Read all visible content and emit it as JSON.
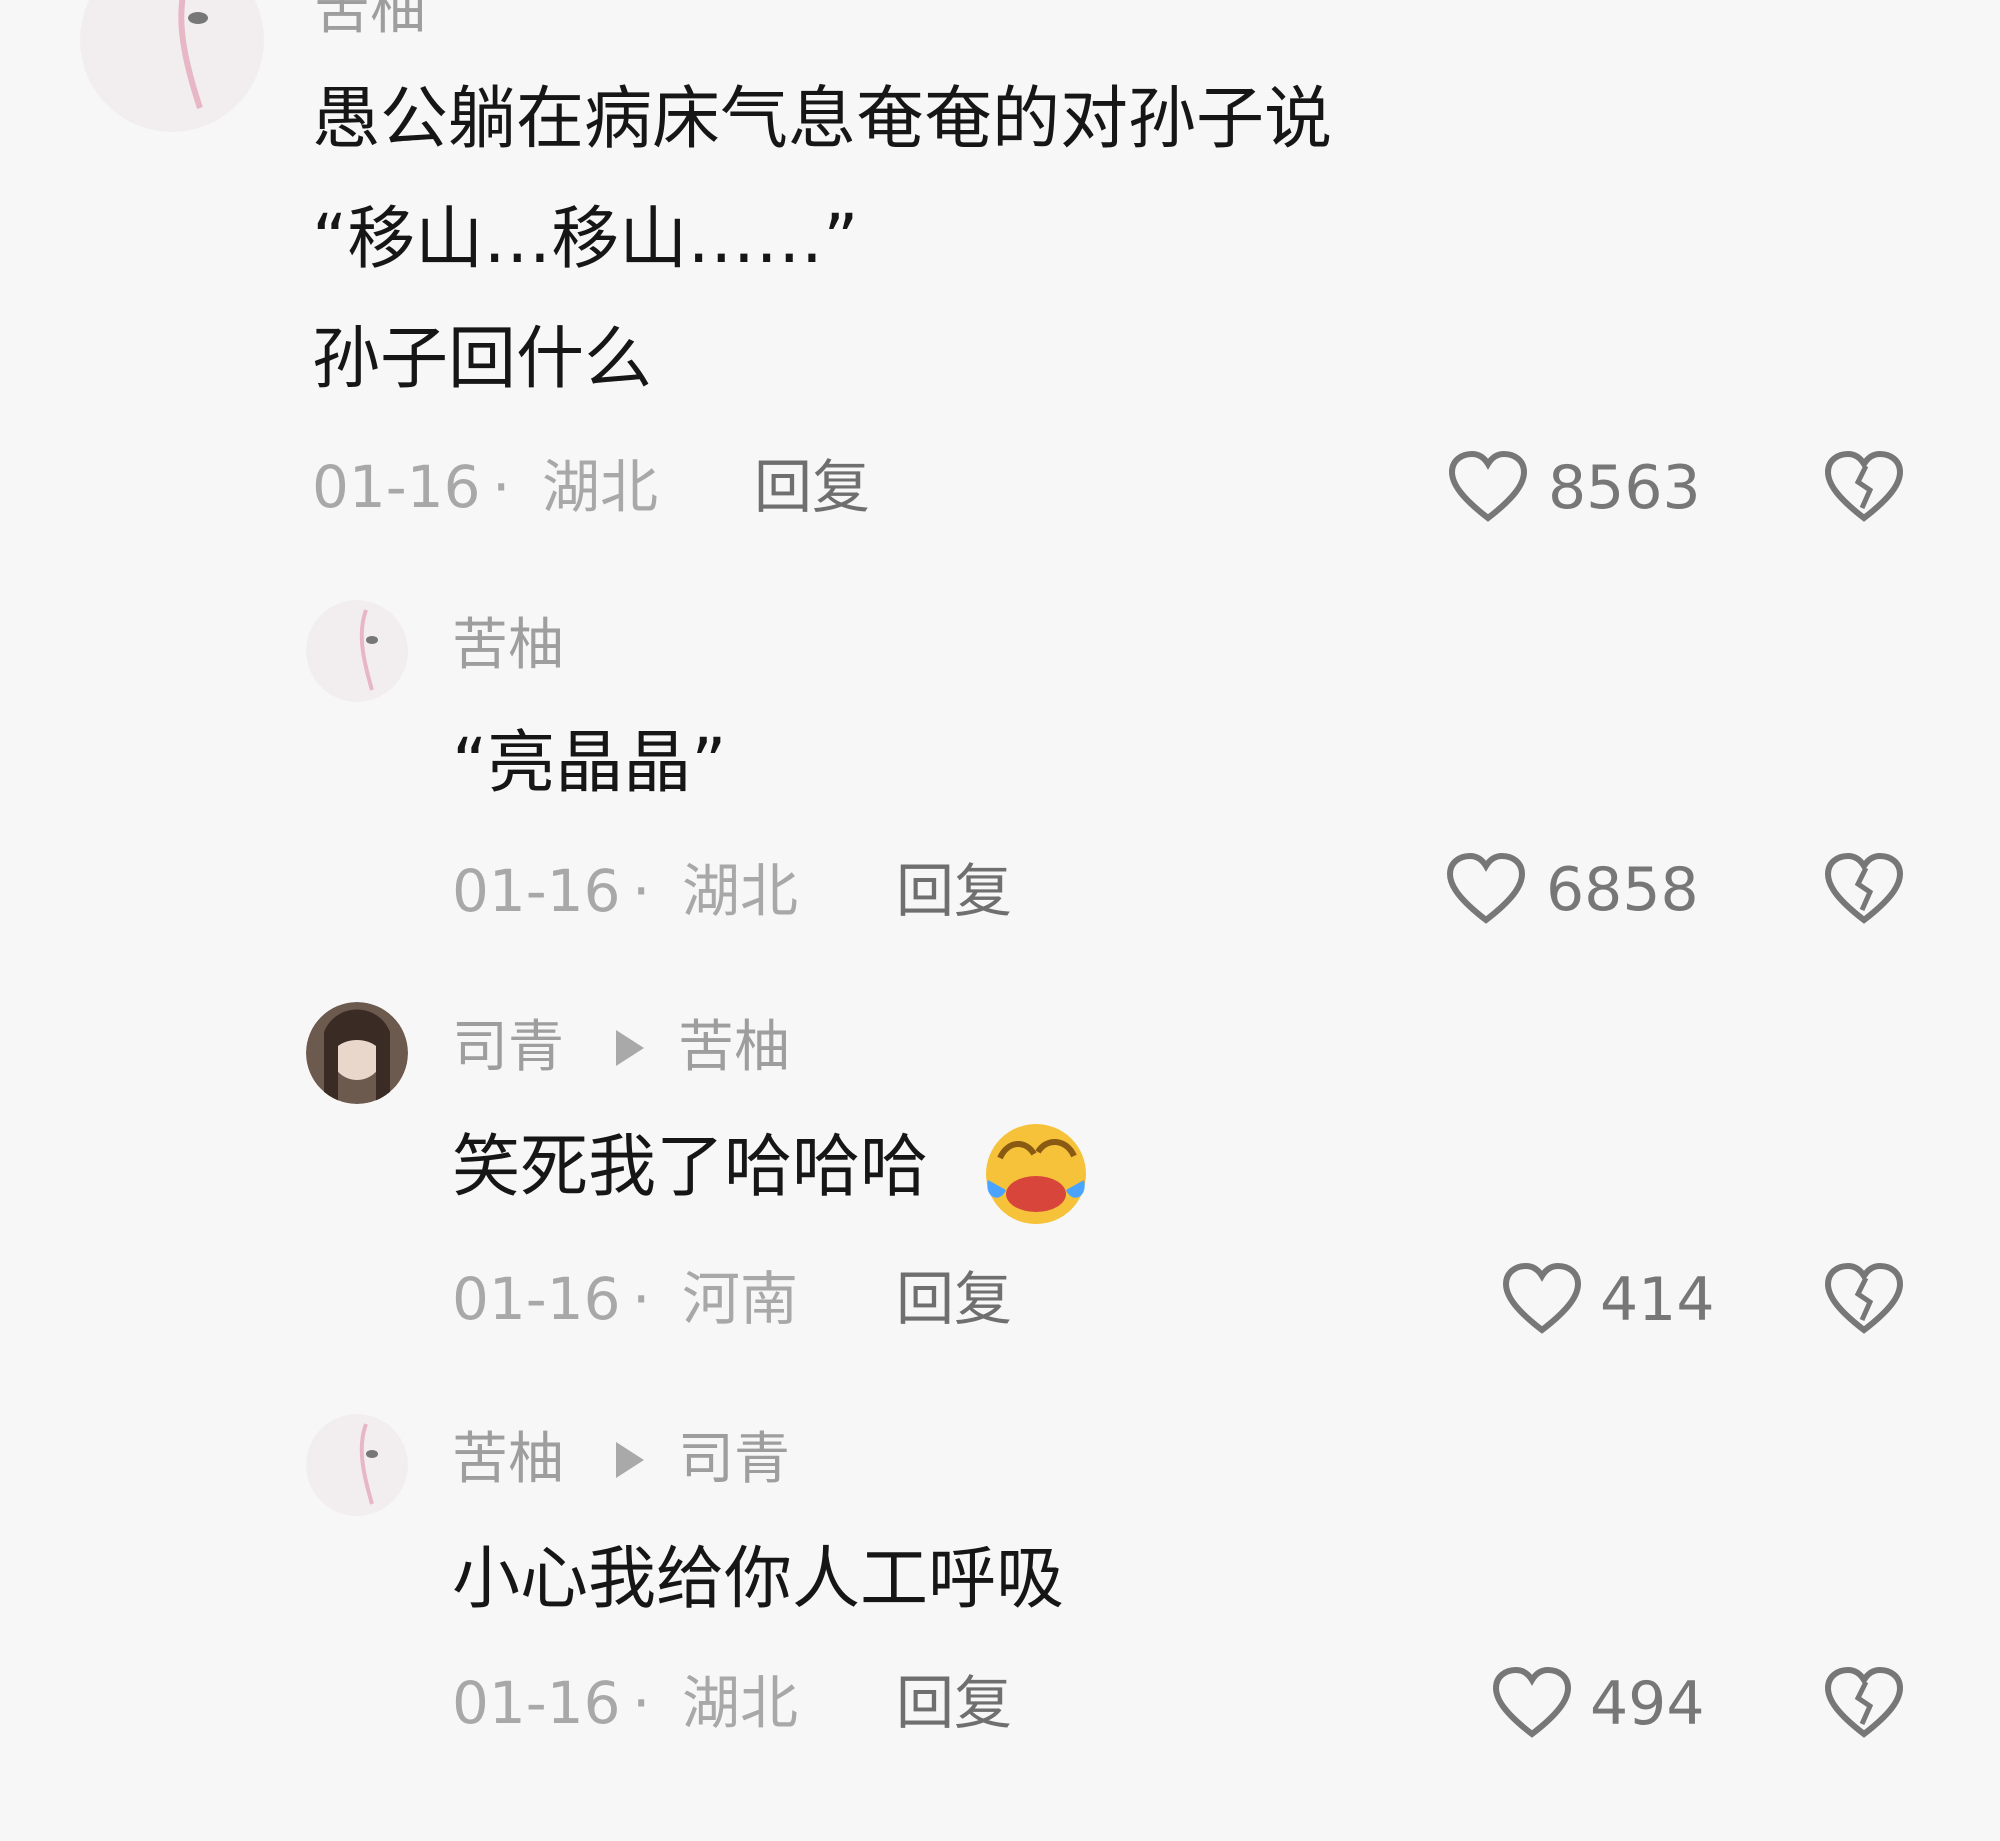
{
  "comment": {
    "username": "苦柚",
    "lines": [
      "愚公躺在病床气息奄奄的对孙子说",
      "“移山…移山……”",
      "孙子回什么"
    ],
    "date": "01-16",
    "location": "湖北",
    "reply_label": "回复",
    "likes": "8563"
  },
  "replies": [
    {
      "username": "苦柚",
      "target": "",
      "text": "“亮晶晶”",
      "date": "01-16",
      "location": "湖北",
      "reply_label": "回复",
      "likes": "6858"
    },
    {
      "username": "司青",
      "target": "苦柚",
      "text": "笑死我了哈哈哈",
      "emoji": "face-with-tears-of-joy",
      "date": "01-16",
      "location": "河南",
      "reply_label": "回复",
      "likes": "414"
    },
    {
      "username": "苦柚",
      "target": "司青",
      "text": "小心我给你人工呼吸",
      "date": "01-16",
      "location": "湖北",
      "reply_label": "回复",
      "likes": "494"
    }
  ],
  "colors": {
    "background": "#f7f7f7",
    "meta": "#a8a8a8",
    "text": "#161616"
  }
}
